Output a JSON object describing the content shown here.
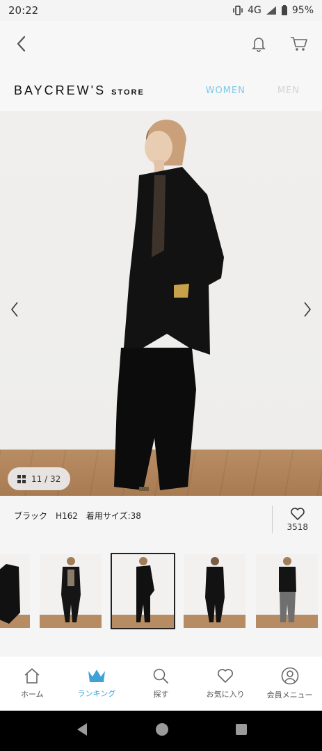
{
  "status_bar": {
    "time": "20:22",
    "network": "4G",
    "battery": "95%"
  },
  "header": {
    "back_icon": "chevron-left-icon",
    "bell_icon": "bell-icon",
    "cart_icon": "cart-icon"
  },
  "brand": {
    "logo": "BAYCREW'S",
    "logo_suffix": "STORE",
    "tab_women": "WOMEN",
    "tab_men": "MEN",
    "tab_women_color": "#7ec9e9",
    "tab_men_color": "#d3d3d3"
  },
  "gallery": {
    "counter": "11 / 32",
    "current": 11,
    "total": 32
  },
  "product_info": {
    "color_size": "ブラック　H162　着用サイズ:38",
    "favorites": "3518"
  },
  "nav": {
    "items": [
      {
        "label": "ホーム",
        "icon": "home-icon"
      },
      {
        "label": "ランキング",
        "icon": "crown-icon"
      },
      {
        "label": "探す",
        "icon": "search-icon"
      },
      {
        "label": "お気に入り",
        "icon": "heart-icon"
      },
      {
        "label": "会員メニュー",
        "icon": "user-icon"
      }
    ],
    "active_index": 1,
    "active_color": "#3ea2d9"
  }
}
